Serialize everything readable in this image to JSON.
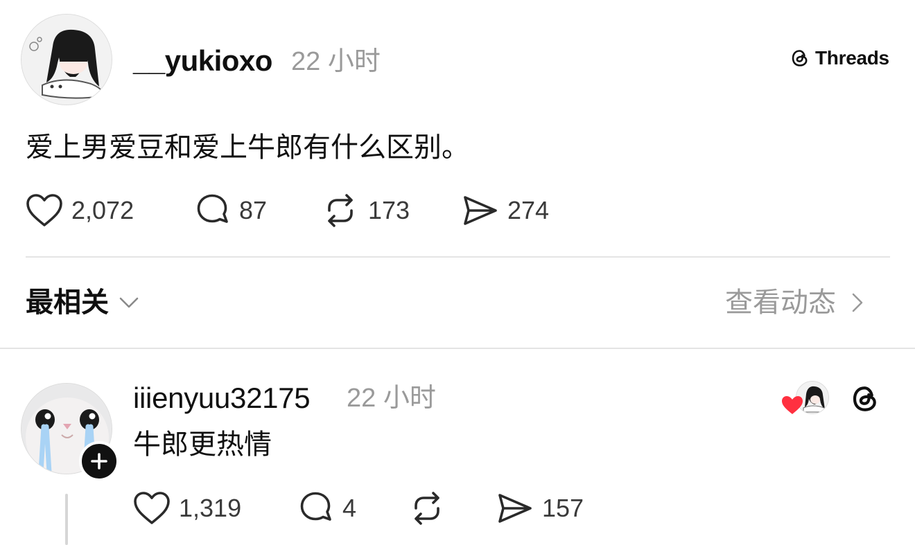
{
  "brand": {
    "name": "Threads"
  },
  "post": {
    "username": "__yukioxo",
    "time": "22 小时",
    "content": "爱上男爱豆和爱上牛郎有什么区别。",
    "stats": {
      "likes": "2,072",
      "replies": "87",
      "reposts": "173",
      "shares": "274"
    }
  },
  "sort": {
    "label": "最相关",
    "activity_label": "查看动态"
  },
  "reply": {
    "username": "iiienyuu32175",
    "time": "22 小时",
    "content": "牛郎更热情",
    "stats": {
      "likes": "1,319",
      "replies": "4",
      "reposts": "",
      "shares": "157"
    }
  },
  "icons": {
    "like": "heart-icon",
    "reply": "comment-bubble-icon",
    "repost": "repost-arrows-icon",
    "share": "send-plane-icon",
    "brand": "threads-logo-icon",
    "follow": "plus-icon",
    "sort_toggle": "chevron-down-icon",
    "activity": "chevron-right-icon",
    "liked_by_author": "red-heart-icon"
  },
  "colors": {
    "text": "#101010",
    "muted": "#9a9a9a",
    "heart": "#ff3040",
    "divider": "#e4e4e4"
  }
}
